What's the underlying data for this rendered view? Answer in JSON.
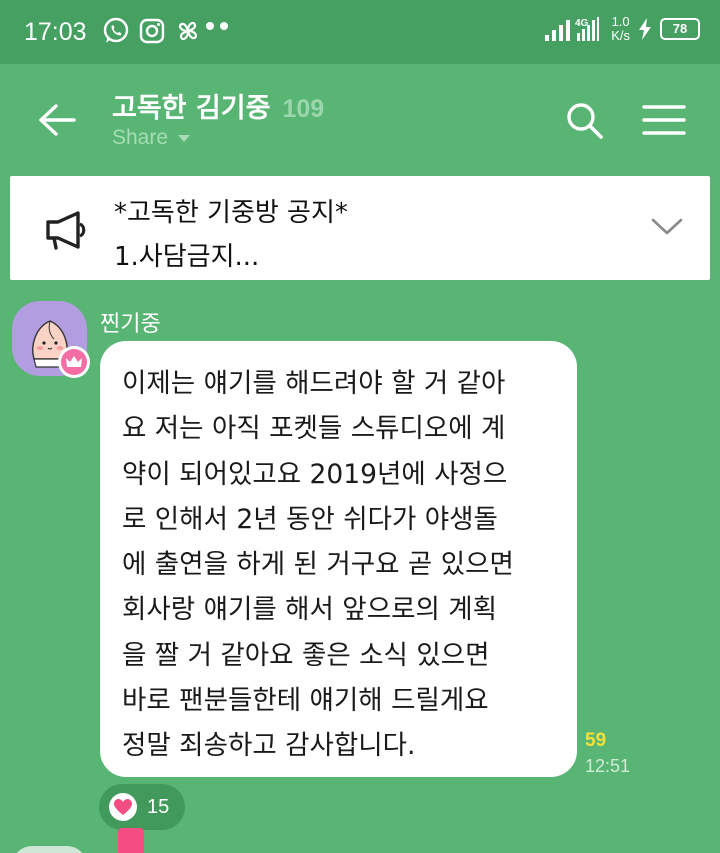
{
  "status_bar": {
    "time": "17:03",
    "network": "4G",
    "speed_value": "1.0",
    "speed_unit": "K/s",
    "battery": "78",
    "icons": [
      "whatsapp-icon",
      "instagram-icon",
      "pinwheel-icon",
      "more-dots-icon",
      "signal-icon",
      "lightning-icon",
      "battery-icon"
    ]
  },
  "header": {
    "title": "고독한 김기중",
    "member_count": "109",
    "share_label": "Share"
  },
  "notice": {
    "title": "*고독한 기중방 공지*",
    "body": "1.사담금지..."
  },
  "message": {
    "sender": "찐기중",
    "text": "이제는 얘기를 해드려야 할 거 같아\n요 저는 아직 포켓들 스튜디오에 계\n약이 되어있고요 2019년에 사정으\n로 인해서 2년 동안 쉬다가 야생돌\n에 출연을 하게 된 거구요 곧 있으면\n회사랑 얘기를 해서 앞으로의 계획\n을 짤 거 같아요 좋은 소식 있으면\n바로 팬분들한테 얘기해 드릴게요\n정말 죄송하고 감사합니다.",
    "unread_count": "59",
    "time": "12:51",
    "reaction_count": "15"
  },
  "colors": {
    "background": "#58b574",
    "status_bar": "#45a062",
    "reaction_pill": "#419a5b",
    "unread": "#f4e03b",
    "heart": "#f44d82"
  }
}
